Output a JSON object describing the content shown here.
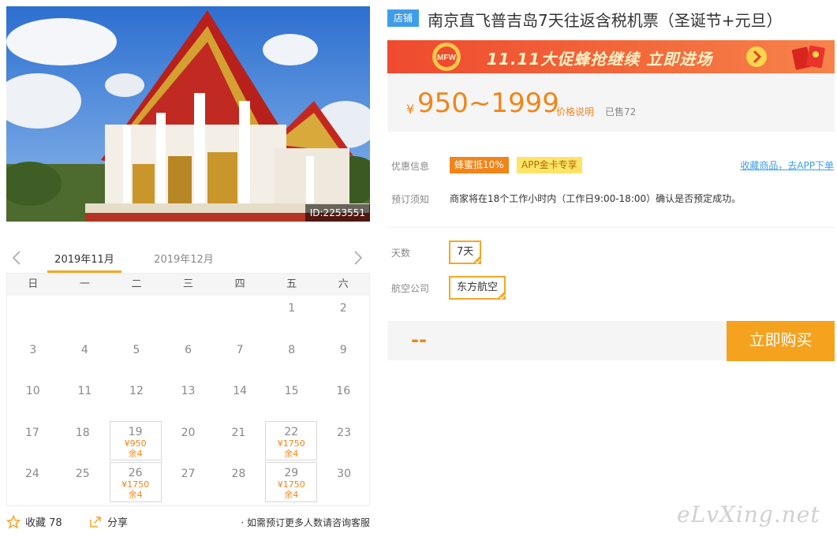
{
  "photo": {
    "id_label": "ID:2253551"
  },
  "calendar": {
    "months": [
      "2019年11月",
      "2019年12月"
    ],
    "weekdays": [
      "日",
      "一",
      "二",
      "三",
      "四",
      "五",
      "六"
    ],
    "rows": [
      [
        {
          "d": ""
        },
        {
          "d": ""
        },
        {
          "d": ""
        },
        {
          "d": ""
        },
        {
          "d": ""
        },
        {
          "d": "1"
        },
        {
          "d": "2"
        }
      ],
      [
        {
          "d": "3"
        },
        {
          "d": "4"
        },
        {
          "d": "5"
        },
        {
          "d": "6"
        },
        {
          "d": "7"
        },
        {
          "d": "8"
        },
        {
          "d": "9"
        }
      ],
      [
        {
          "d": "10"
        },
        {
          "d": "11"
        },
        {
          "d": "12"
        },
        {
          "d": "13"
        },
        {
          "d": "14"
        },
        {
          "d": "15"
        },
        {
          "d": "16"
        }
      ],
      [
        {
          "d": "17"
        },
        {
          "d": "18"
        },
        {
          "d": "19",
          "price": "¥950",
          "stock": "余4"
        },
        {
          "d": "20"
        },
        {
          "d": "21"
        },
        {
          "d": "22",
          "price": "¥1750",
          "stock": "余4"
        },
        {
          "d": "23"
        }
      ],
      [
        {
          "d": "24"
        },
        {
          "d": "25"
        },
        {
          "d": "26",
          "price": "¥1750",
          "stock": "余4"
        },
        {
          "d": "27"
        },
        {
          "d": "28"
        },
        {
          "d": "29",
          "price": "¥1750",
          "stock": "余4"
        },
        {
          "d": "30"
        }
      ]
    ]
  },
  "footer": {
    "fav_label": "收藏 78",
    "share_label": "分享",
    "consult_text": "· 如需预订更多人数请咨询客服"
  },
  "product": {
    "shop_badge": "店铺",
    "title": "南京直飞普吉岛7天往返含税机票（圣诞节+元旦）",
    "promo_text": "11.11大促蜂抢继续 立即进场",
    "yen": "¥",
    "price_range": "950~1999",
    "price_note": "价格说明",
    "sold": "已售72"
  },
  "info": {
    "discount_label": "优惠信息",
    "discount_tag": "蜂蜜抵10%",
    "app_tag": "APP金卡专享",
    "fav_link": "收藏商品，去APP下单",
    "notice_label": "预订须知",
    "notice_text": "商家将在18个工作小时内（工作日9:00-18:00）确认是否预定成功。"
  },
  "options": {
    "days_label": "天数",
    "days_value": "7天",
    "airline_label": "航空公司",
    "airline_value": "东方航空"
  },
  "buy": {
    "dash": "--",
    "button_label": "立即购买"
  },
  "watermark": "eLvXing.net",
  "colors": {
    "accent": "#f08519",
    "button": "#f5a21e",
    "badge": "#3f9de8",
    "tab_underline": "#f5a623"
  }
}
